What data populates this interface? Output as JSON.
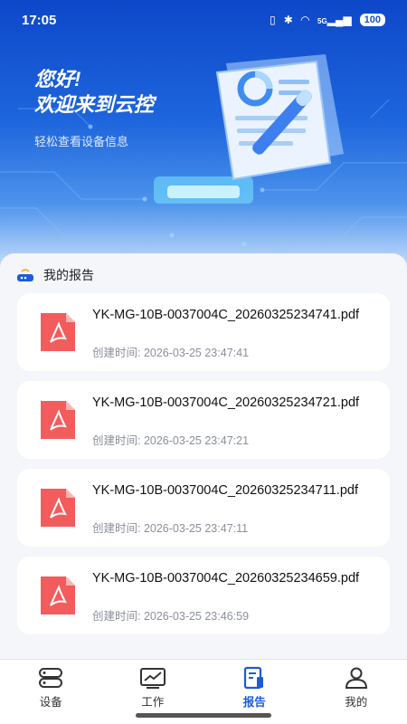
{
  "status_bar": {
    "time": "17:05",
    "battery": "100",
    "signal_label": "5G"
  },
  "header": {
    "greeting_line1": "您好!",
    "greeting_line2": "欢迎来到云控",
    "subtitle": "轻松查看设备信息"
  },
  "reports": {
    "section_title": "我的报告",
    "items": [
      {
        "file_name": "YK-MG-10B-0037004C_20260325234741.pdf",
        "created": "创建时间: 2026-03-25 23:47:41"
      },
      {
        "file_name": "YK-MG-10B-0037004C_20260325234721.pdf",
        "created": "创建时间: 2026-03-25 23:47:21"
      },
      {
        "file_name": "YK-MG-10B-0037004C_20260325234711.pdf",
        "created": "创建时间: 2026-03-25 23:47:11"
      },
      {
        "file_name": "YK-MG-10B-0037004C_20260325234659.pdf",
        "created": "创建时间: 2026-03-25 23:46:59"
      }
    ]
  },
  "tabbar": {
    "items": [
      {
        "label": "设备",
        "icon": "device-icon",
        "active": false
      },
      {
        "label": "工作",
        "icon": "chart-icon",
        "active": false
      },
      {
        "label": "报告",
        "icon": "report-icon",
        "active": true
      },
      {
        "label": "我的",
        "icon": "user-icon",
        "active": false
      }
    ]
  },
  "colors": {
    "accent": "#1d5ad8",
    "pdf_red": "#f25c5c",
    "banner_blue": "#1452c8"
  }
}
